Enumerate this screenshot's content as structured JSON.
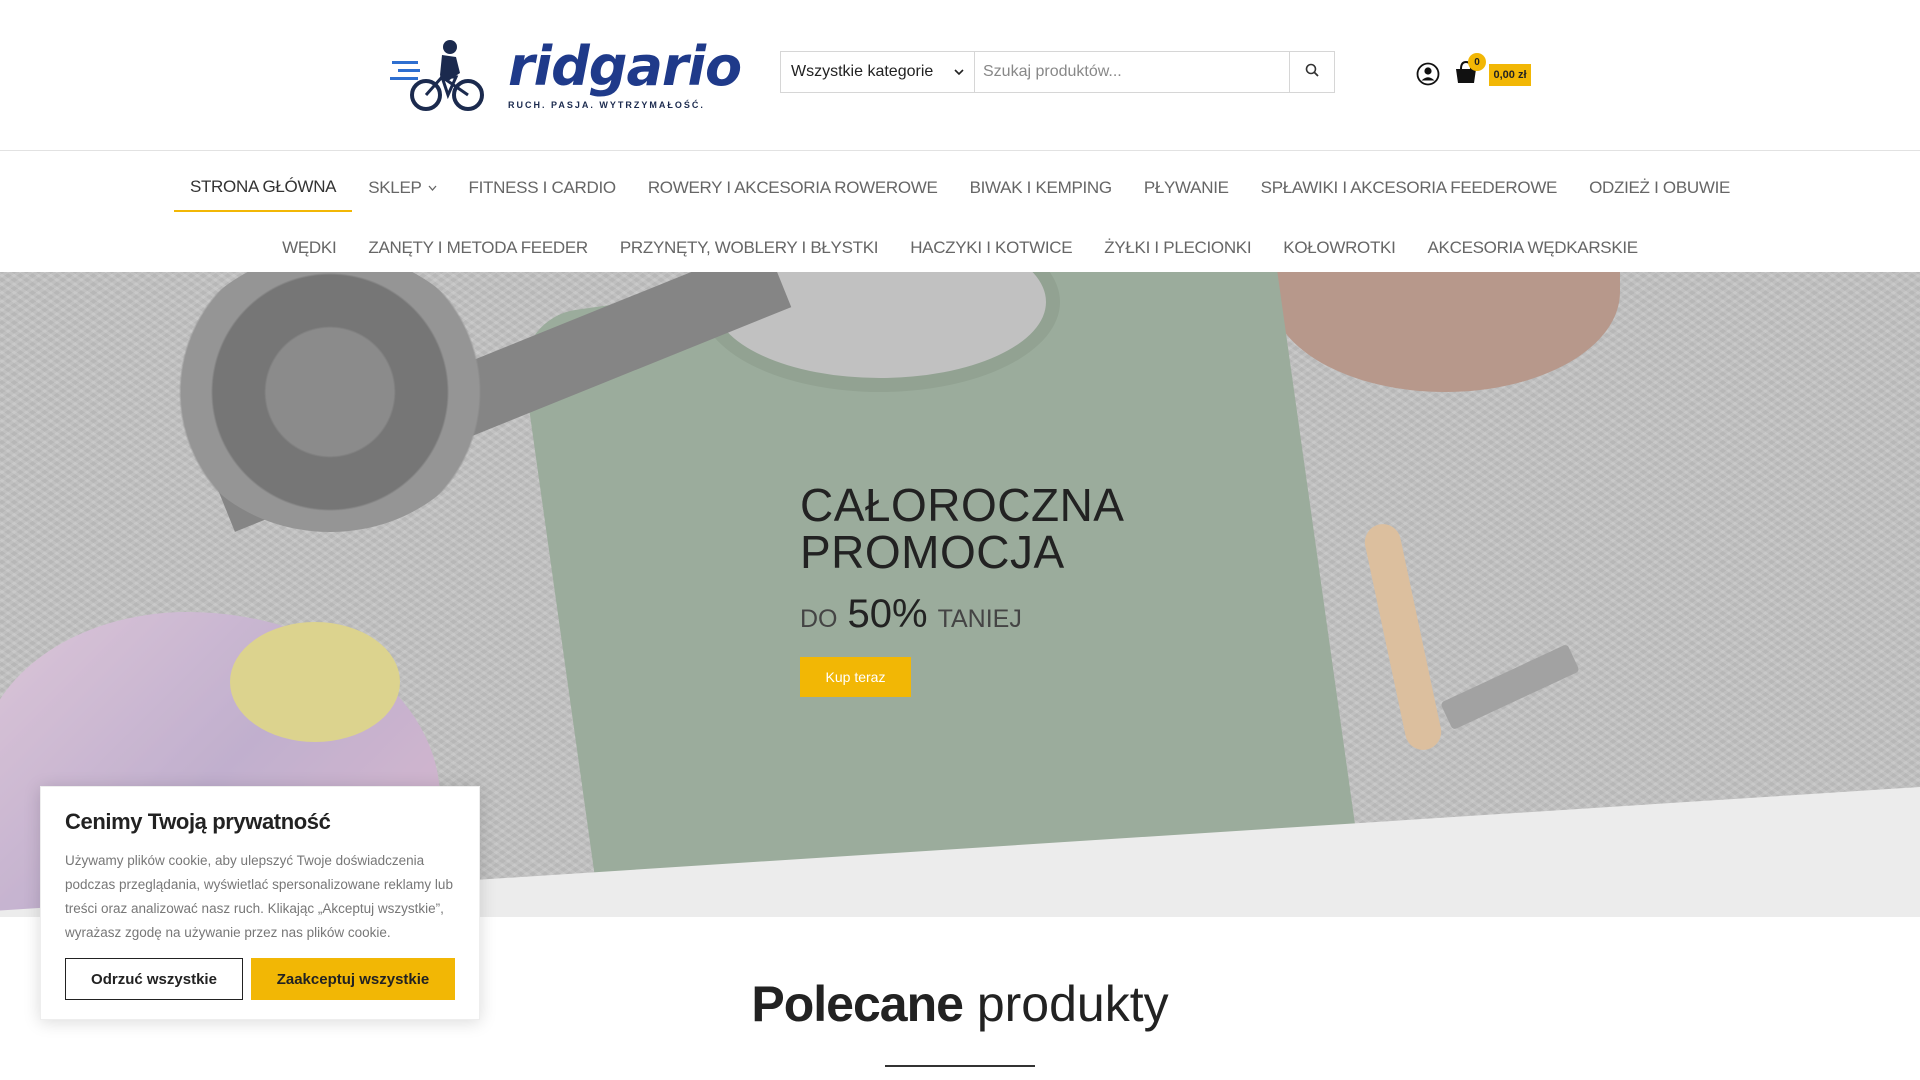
{
  "logo": {
    "text": "ridgario",
    "tagline": "RUCH. PASJA. WYTRZYMAŁOŚĆ."
  },
  "search": {
    "category_selected": "Wszystkie kategorie",
    "placeholder": "Szukaj produktów..."
  },
  "cart": {
    "count": "0",
    "total": "0,00 zł"
  },
  "nav": {
    "row1": [
      "STRONA GŁÓWNA",
      "SKLEP",
      "FITNESS I CARDIO",
      "ROWERY I AKCESORIA ROWEROWE",
      "BIWAK I KEMPING",
      "PŁYWANIE",
      "SPŁAWIKI I AKCESORIA FEEDEROWE",
      "ODZIEŻ I OBUWIE"
    ],
    "row2": [
      "WĘDKI",
      "ZANĘTY I METODA FEEDER",
      "PRZYNĘTY, WOBLERY I BŁYSTKI",
      "HACZYKI I KOTWICE",
      "ŻYŁKI I PLECIONKI",
      "KOŁOWROTKI",
      "AKCESORIA WĘDKARSKIE"
    ]
  },
  "hero": {
    "title_line1": "CAŁOROCZNA",
    "title_line2": "PROMOCJA",
    "sub_prefix": "DO",
    "sub_value": "50%",
    "sub_suffix": "TANIEJ",
    "button": "Kup teraz"
  },
  "featured": {
    "title_bold": "Polecane",
    "title_regular": "produkty"
  },
  "cookie": {
    "title": "Cenimy Twoją prywatność",
    "text": "Używamy plików cookie, aby ulepszyć Twoje doświadczenia podczas przeglądania, wyświetlać spersonalizowane reklamy lub treści oraz analizować nasz ruch. Klikając „Akceptuj wszystkie”, wyrażasz zgodę na używanie przez nas plików cookie.",
    "reject": "Odrzuć wszystkie",
    "accept": "Zaakceptuj wszystkie"
  },
  "colors": {
    "accent": "#f2b705",
    "brand": "#1f3a8a"
  }
}
